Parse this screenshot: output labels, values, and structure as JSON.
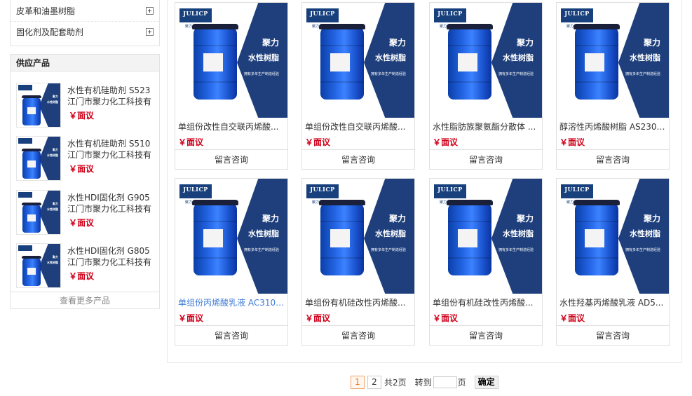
{
  "categories": [
    {
      "label": "皮革和油墨树脂"
    },
    {
      "label": "固化剂及配套助剂"
    }
  ],
  "supply": {
    "title": "供应产品",
    "more_label": "查看更多产品",
    "items": [
      {
        "name": "水性有机硅助剂 S523",
        "company": "江门市聚力化工科技有",
        "price": "￥面议"
      },
      {
        "name": "水性有机硅助剂 S510",
        "company": "江门市聚力化工科技有",
        "price": "￥面议"
      },
      {
        "name": "水性HDI固化剂 G905",
        "company": "江门市聚力化工科技有",
        "price": "￥面议"
      },
      {
        "name": "水性HDI固化剂 G805",
        "company": "江门市聚力化工科技有",
        "price": "￥面议"
      }
    ]
  },
  "image_text": {
    "brand": "JULICP",
    "brand_sub": "聚力水性树脂",
    "slogan_1": "聚力",
    "slogan_2": "水性树脂",
    "slogan_3": "拥有多年生产制造经验"
  },
  "products": [
    {
      "name": "单组份改性自交联丙烯酸...",
      "price": "￥面议",
      "button": "留言咨询",
      "highlight": false
    },
    {
      "name": "单组份改性自交联丙烯酸...",
      "price": "￥面议",
      "button": "留言咨询",
      "highlight": false
    },
    {
      "name": "水性脂肪族聚氨酯分散体 ...",
      "price": "￥面议",
      "button": "留言咨询",
      "highlight": false
    },
    {
      "name": "醇溶性丙烯酸树脂 AS230 ...",
      "price": "￥面议",
      "button": "留言咨询",
      "highlight": false
    },
    {
      "name": "单组份丙烯酸乳液 AC310 ...",
      "price": "￥面议",
      "button": "留言咨询",
      "highlight": true
    },
    {
      "name": "单组份有机硅改性丙烯酸...",
      "price": "￥面议",
      "button": "留言咨询",
      "highlight": false
    },
    {
      "name": "单组份有机硅改性丙烯酸...",
      "price": "￥面议",
      "button": "留言咨询",
      "highlight": false
    },
    {
      "name": "水性羟基丙烯酸乳液 AD5...",
      "price": "￥面议",
      "button": "留言咨询",
      "highlight": false
    }
  ],
  "pagination": {
    "pages": [
      "1",
      "2"
    ],
    "current": "1",
    "total_label": "共2页",
    "goto_label": "转到",
    "page_unit": "页",
    "confirm_label": "确定",
    "input_value": ""
  },
  "colors": {
    "price": "#d0021b",
    "highlight_link": "#3d7bd6",
    "drum_blue": "#2466e6",
    "banner_navy": "#1e3f7c"
  }
}
